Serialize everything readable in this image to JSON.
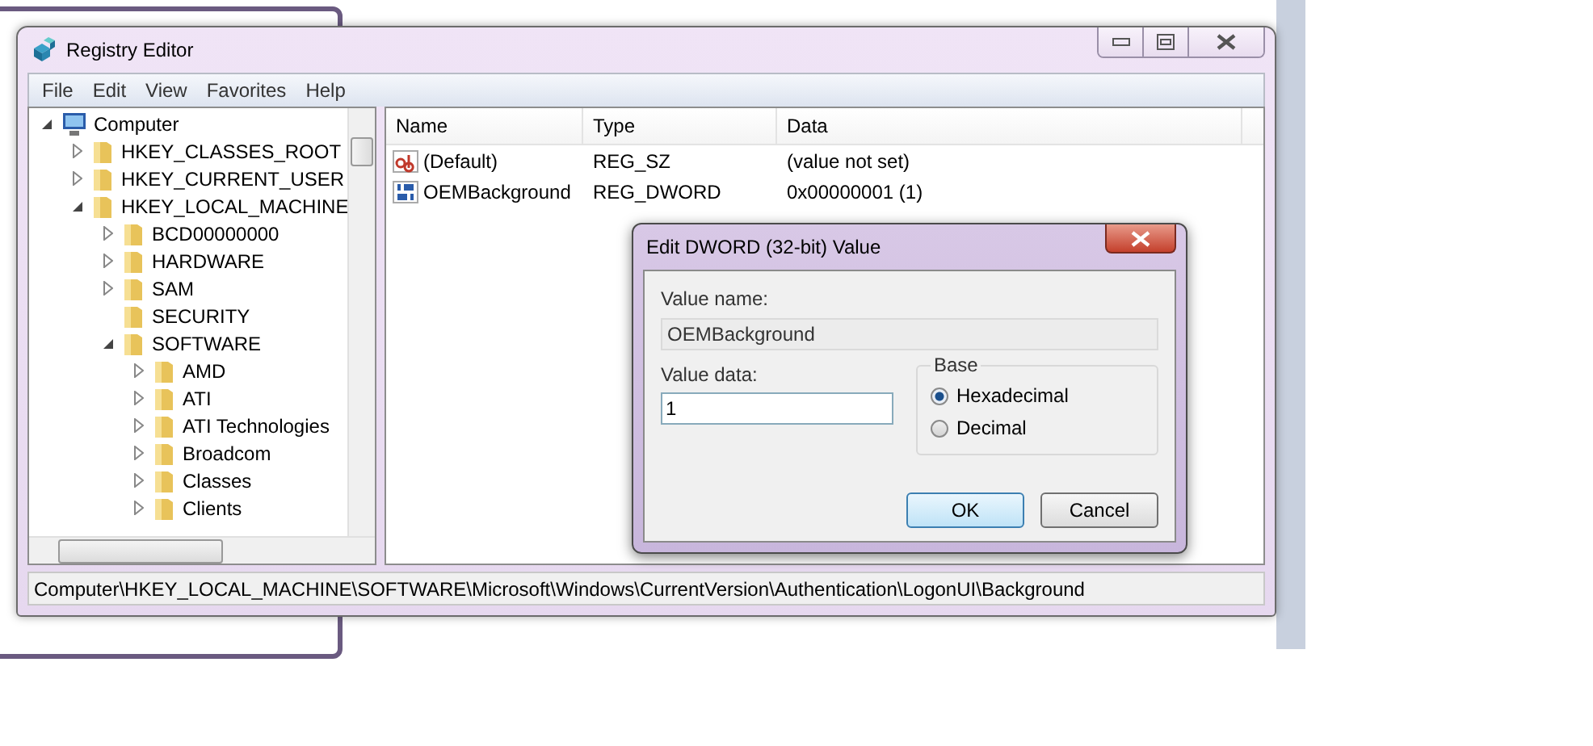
{
  "window": {
    "title": "Registry Editor"
  },
  "menu": [
    "File",
    "Edit",
    "View",
    "Favorites",
    "Help"
  ],
  "tree": [
    {
      "label": "Computer",
      "kind": "computer",
      "expanded": true,
      "children": [
        {
          "label": "HKEY_CLASSES_ROOT",
          "kind": "folder",
          "expanded": false
        },
        {
          "label": "HKEY_CURRENT_USER",
          "kind": "folder",
          "expanded": false
        },
        {
          "label": "HKEY_LOCAL_MACHINE",
          "kind": "folder",
          "expanded": true,
          "children": [
            {
              "label": "BCD00000000",
              "kind": "folder",
              "expanded": false
            },
            {
              "label": "HARDWARE",
              "kind": "folder",
              "expanded": false
            },
            {
              "label": "SAM",
              "kind": "folder",
              "expanded": false
            },
            {
              "label": "SECURITY",
              "kind": "folder"
            },
            {
              "label": "SOFTWARE",
              "kind": "folder",
              "expanded": true,
              "children": [
                {
                  "label": "AMD",
                  "kind": "folder",
                  "expanded": false
                },
                {
                  "label": "ATI",
                  "kind": "folder",
                  "expanded": false
                },
                {
                  "label": "ATI Technologies",
                  "kind": "folder",
                  "expanded": false
                },
                {
                  "label": "Broadcom",
                  "kind": "folder",
                  "expanded": false
                },
                {
                  "label": "Classes",
                  "kind": "folder",
                  "expanded": false
                },
                {
                  "label": "Clients",
                  "kind": "folder",
                  "expanded": false
                }
              ]
            }
          ]
        }
      ]
    }
  ],
  "list": {
    "columns": [
      "Name",
      "Type",
      "Data"
    ],
    "rows": [
      {
        "name": "(Default)",
        "type": "REG_SZ",
        "data": "(value not set)",
        "kind": "string"
      },
      {
        "name": "OEMBackground",
        "type": "REG_DWORD",
        "data": "0x00000001 (1)",
        "kind": "binary"
      }
    ]
  },
  "status_bar": "Computer\\HKEY_LOCAL_MACHINE\\SOFTWARE\\Microsoft\\Windows\\CurrentVersion\\Authentication\\LogonUI\\Background",
  "dialog": {
    "title": "Edit DWORD (32-bit) Value",
    "value_name_label": "Value name:",
    "value_name": "OEMBackground",
    "value_data_label": "Value data:",
    "value_data": "1",
    "base_label": "Base",
    "bases": [
      {
        "label": "Hexadecimal",
        "selected": true
      },
      {
        "label": "Decimal",
        "selected": false
      }
    ],
    "buttons": [
      {
        "label": "OK",
        "default": true
      },
      {
        "label": "Cancel",
        "default": false
      }
    ]
  }
}
